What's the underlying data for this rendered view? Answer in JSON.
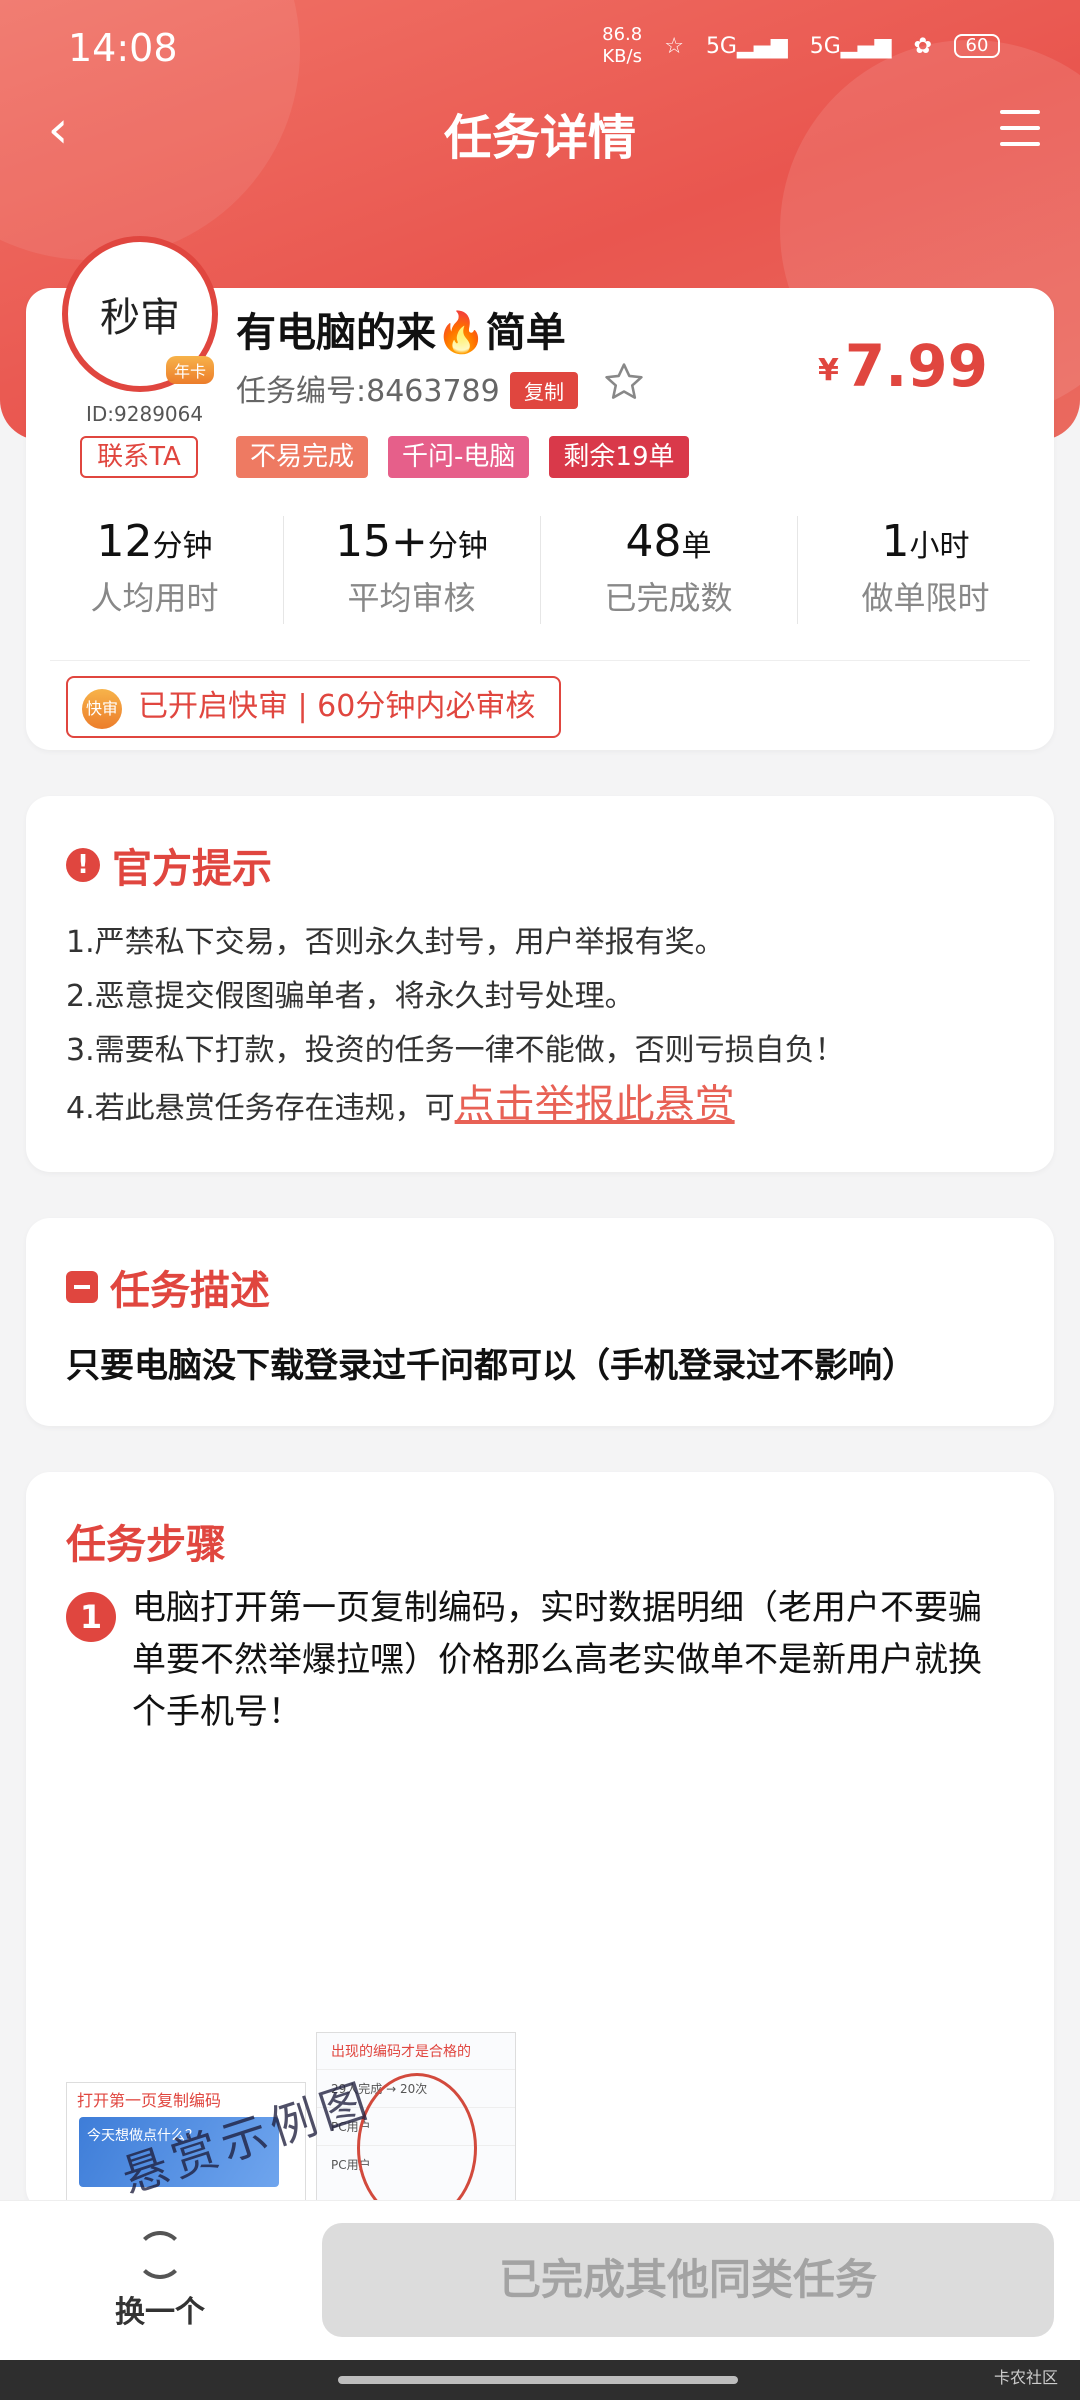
{
  "status_bar": {
    "time": "14:08",
    "net_speed_value": "86.8",
    "net_speed_unit": "KB/s",
    "signal_1": "5G",
    "signal_2": "5G",
    "battery": "60"
  },
  "nav": {
    "title": "任务详情"
  },
  "task": {
    "avatar_text": "秒审",
    "avatar_badge": "年卡",
    "user_id": "ID:9289064",
    "contact_label": "联系TA",
    "title": "有电脑的来🔥简单",
    "task_no": "任务编号:8463789",
    "copy_label": "复制",
    "price_symbol": "¥",
    "price": "7.99",
    "tags": [
      "不易完成",
      "千问-电脑",
      "剩余19单"
    ],
    "stats": [
      {
        "value": "12",
        "unit": "分钟",
        "label": "人均用时"
      },
      {
        "value": "15+",
        "unit": "分钟",
        "label": "平均审核"
      },
      {
        "value": "48",
        "unit": "单",
        "label": "已完成数"
      },
      {
        "value": "1",
        "unit": "小时",
        "label": "做单限时"
      }
    ],
    "fast_review_icon": "快审",
    "fast_review_text": "已开启快审 | 60分钟内必审核"
  },
  "notice": {
    "title": "官方提示",
    "lines": [
      "1.严禁私下交易，否则永久封号，用户举报有奖。",
      "2.恶意提交假图骗单者，将永久封号处理。",
      "3.需要私下打款，投资的任务一律不能做，否则亏损自负！",
      "4.若此悬赏任务存在违规，可"
    ],
    "report_link": "点击举报此悬赏"
  },
  "description": {
    "title": "任务描述",
    "text": "只要电脑没下载登录过千问都可以（手机登录过不影响）"
  },
  "steps": {
    "title": "任务步骤",
    "items": [
      {
        "num": "1",
        "text": "电脑打开第一页复制编码，实时数据明细（老用户不要骗单要不然举爆拉嘿）价格那么高老实做单不是新用户就换个手机号！"
      }
    ],
    "thumbnail": {
      "left_header": "打开第一页复制编码",
      "left_banner": "今天想做点什么？",
      "right_header": "出现的编码才是合格的",
      "right_rows": [
        "29人完成 → 20次",
        "PC用户",
        "PC用户"
      ],
      "watermark": "悬赏示例图"
    }
  },
  "bottom": {
    "swap_label": "换一个",
    "primary_label": "已完成其他同类任务"
  },
  "corner_mark": "卡农社区"
}
